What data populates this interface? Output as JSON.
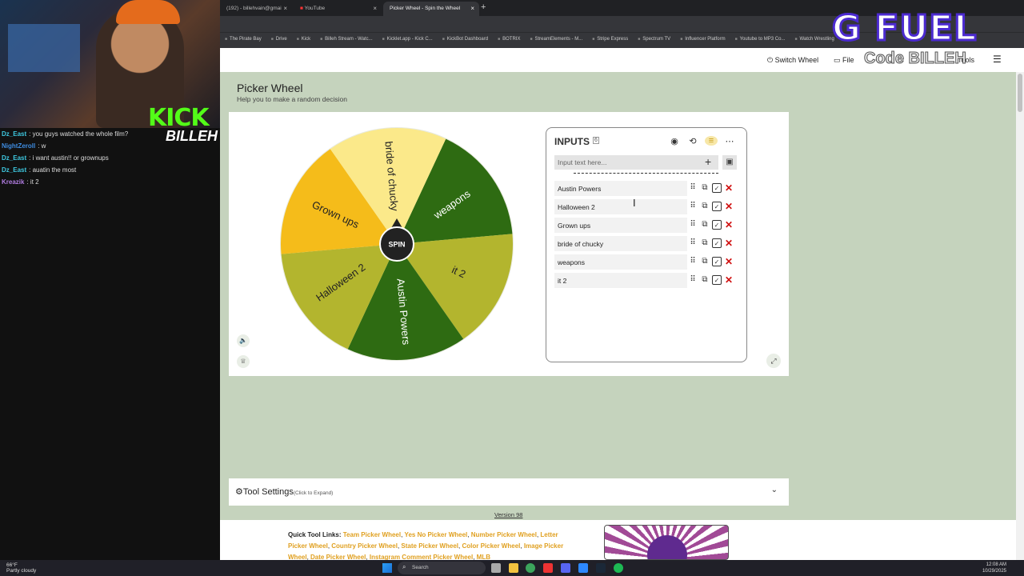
{
  "browser": {
    "tabs": [
      {
        "label": "(192) - billehvain@gmai"
      },
      {
        "label": "YouTube"
      },
      {
        "label": "Picker Wheel - Spin the Wheel"
      }
    ],
    "bookmarks": [
      "The Pirate Bay",
      "Drive",
      "Kick",
      "Billeh Stream - Watc...",
      "Kicklet.app - Kick C...",
      "KickBot Dashboard",
      "BOTRIX",
      "StreamElements - M...",
      "Stripe Express",
      "Spectrum TV",
      "Influencer Platform",
      "Youtube to MP3 Co...",
      "Watch Wrestling"
    ]
  },
  "overlay": {
    "kick_logo": "KICK",
    "kick_sub": "BILLEH",
    "gfuel": "G FUEL",
    "gfuel_code": "Code BILLEH",
    "chat": [
      {
        "user": "Dz_East",
        "msg": ": you guys watched the whole film?",
        "color": "#3ec8e0"
      },
      {
        "user": "NightZeroll",
        "msg": ": w",
        "color": "#3e8ce0"
      },
      {
        "user": "Dz_East",
        "msg": ": i want austin!! or grownups",
        "color": "#3ec8e0"
      },
      {
        "user": "Dz_East",
        "msg": ": auatin the most",
        "color": "#3ec8e0"
      },
      {
        "user": "Kreazik",
        "msg": ": it 2",
        "color": "#b07ce0"
      }
    ]
  },
  "nav": {
    "switch_wheel": "Switch Wheel",
    "file": "File",
    "tools": "Tools"
  },
  "page": {
    "title": "Picker Wheel",
    "subtitle": "Help you to make a random decision",
    "spin_label": "SPIN"
  },
  "wheel": {
    "slices": [
      {
        "label": "weapons",
        "color": "#2e6b12"
      },
      {
        "label": "it 2",
        "color": "#b3b52e"
      },
      {
        "label": "Austin Powers",
        "color": "#2e6b12"
      },
      {
        "label": "Halloween 2",
        "color": "#b3b52e"
      },
      {
        "label": "Grown ups",
        "color": "#f5bc1a"
      },
      {
        "label": "bride of chucky",
        "color": "#fbe98a"
      }
    ]
  },
  "inputs": {
    "title": "INPUTS",
    "count": "6",
    "placeholder": "Input text here...",
    "entries": [
      "Austin Powers",
      "Halloween 2",
      "Grown ups",
      "bride of chucky",
      "weapons",
      "it 2"
    ]
  },
  "tool_settings": {
    "label": "Tool Settings",
    "sub": "(Click to Expand)"
  },
  "version": "Version 98",
  "quick_links": {
    "heading": "Quick Tool Links:",
    "links": [
      "Team Picker Wheel",
      "Yes No Picker Wheel",
      "Number Picker Wheel",
      "Letter Picker Wheel",
      "Country Picker Wheel",
      "State Picker Wheel",
      "Color Picker Wheel",
      "Image Picker Wheel",
      "Date Picker Wheel",
      "Instagram Comment Picker Wheel",
      "MLB"
    ]
  },
  "taskbar": {
    "temp": "66°F",
    "weather": "Partly cloudy",
    "search": "Search",
    "time": "12:08 AM",
    "date": "10/29/2025"
  }
}
